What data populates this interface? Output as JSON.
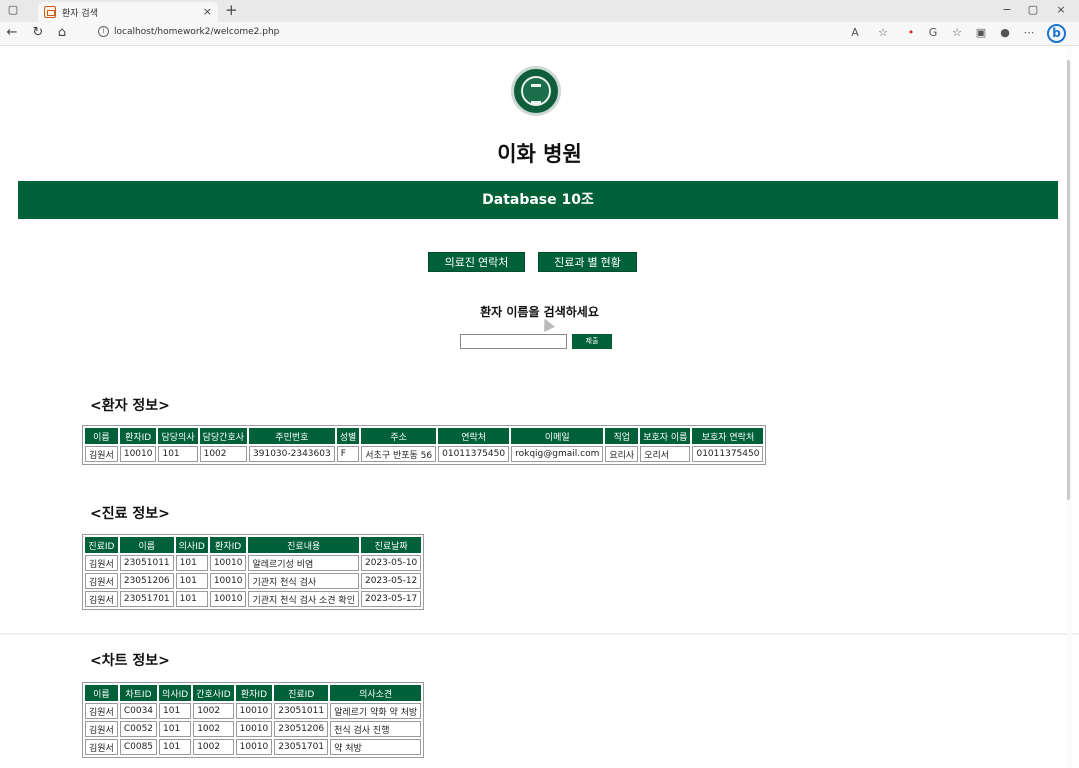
{
  "browser": {
    "tab_title": "환자 검색",
    "tab_close": "×",
    "new_tab": "+",
    "url": "localhost/homework2/welcome2.php",
    "window_controls": [
      "−",
      "▢",
      "×"
    ],
    "nav_icons": [
      "back-icon",
      "refresh-icon",
      "home-icon"
    ],
    "toolbar_icons": [
      "read-aloud-icon",
      "favorite-icon",
      "extension-icon",
      "copilot-icon",
      "favorites-bar-icon",
      "collections-icon",
      "profile-icon",
      "more-icon",
      "bing-icon"
    ]
  },
  "header": {
    "hospital_name": "이화 병원",
    "banner": "Database 10조"
  },
  "nav_buttons": {
    "staff_contact": "의료진 연락처",
    "department_status": "진료과 별 현황"
  },
  "search": {
    "title": "환자 이름을 검색하세요",
    "input_value": "",
    "submit_label": "제출"
  },
  "patient": {
    "title": "<환자 정보>",
    "headers": [
      "이름",
      "환자ID",
      "담당의사",
      "담당간호사",
      "주민번호",
      "성별",
      "주소",
      "연락처",
      "이메일",
      "직업",
      "보호자 이름",
      "보호자 연락처"
    ],
    "rows": [
      [
        "김원서",
        "10010",
        "101",
        "1002",
        "391030-2343603",
        "F",
        "서초구 반포동 56",
        "01011375450",
        "rokqig@gmail.com",
        "요리사",
        "오리서",
        "01011375450"
      ]
    ]
  },
  "treatment": {
    "title": "<진료 정보>",
    "headers": [
      "진료ID",
      "이름",
      "의사ID",
      "환자ID",
      "진료내용",
      "진료날짜"
    ],
    "rows": [
      [
        "김원서",
        "23051011",
        "101",
        "10010",
        "알레르기성 비염",
        "2023-05-10"
      ],
      [
        "김원서",
        "23051206",
        "101",
        "10010",
        "기관지 천식 검사",
        "2023-05-12"
      ],
      [
        "김원서",
        "23051701",
        "101",
        "10010",
        "기관지 천식 검사 소견 확인",
        "2023-05-17"
      ]
    ]
  },
  "chart": {
    "title": "<차트 정보>",
    "headers": [
      "이름",
      "차트ID",
      "의사ID",
      "간호사ID",
      "환자ID",
      "진료ID",
      "의사소견"
    ],
    "rows": [
      [
        "김원서",
        "C0034",
        "101",
        "1002",
        "10010",
        "23051011",
        "알레르기 약화 약 처방"
      ],
      [
        "김원서",
        "C0052",
        "101",
        "1002",
        "10010",
        "23051206",
        "천식 검사 진행"
      ],
      [
        "김원서",
        "C0085",
        "101",
        "1002",
        "10010",
        "23051701",
        "약 처방"
      ]
    ]
  },
  "colors": {
    "brand_green": "#006139",
    "header_cell": "#00603a"
  }
}
